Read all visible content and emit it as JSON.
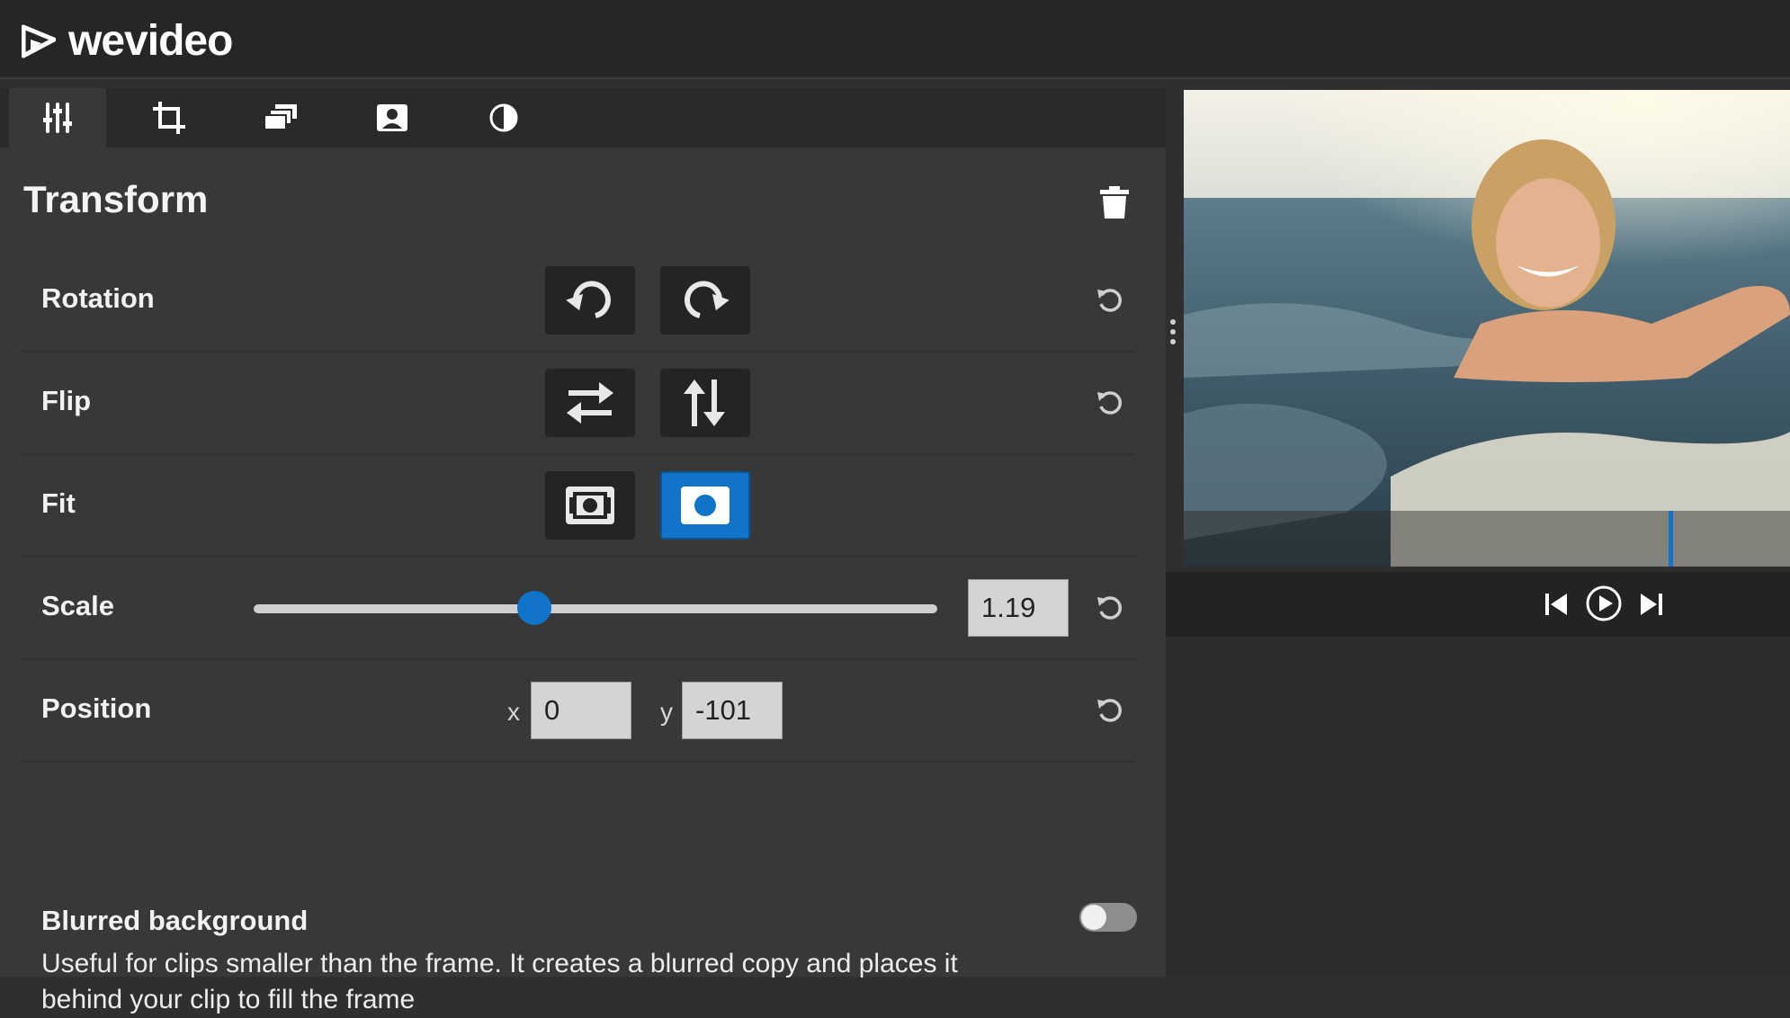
{
  "app": {
    "logo_text": "wevideo"
  },
  "tabs": [
    {
      "name": "adjust",
      "icon": "sliders-icon",
      "active": true
    },
    {
      "name": "crop",
      "icon": "crop-icon",
      "active": false
    },
    {
      "name": "layers",
      "icon": "layers-icon",
      "active": false
    },
    {
      "name": "portrait",
      "icon": "portrait-icon",
      "active": false
    },
    {
      "name": "contrast",
      "icon": "contrast-icon",
      "active": false
    }
  ],
  "panel": {
    "title": "Transform"
  },
  "rows": {
    "rotation": {
      "label": "Rotation"
    },
    "flip": {
      "label": "Flip"
    },
    "fit": {
      "label": "Fit",
      "selected": "fill"
    },
    "scale": {
      "label": "Scale",
      "value": "1.19",
      "slider_fraction": 0.41
    },
    "position": {
      "label": "Position",
      "x_label": "x",
      "x_value": "0",
      "y_label": "y",
      "y_value": "-101"
    }
  },
  "blur": {
    "title": "Blurred background",
    "description": "Useful for clips smaller than the frame. It creates a blurred copy and places it behind your clip to fill the frame",
    "enabled": false
  },
  "player": {
    "playhead_fraction": 0.8
  },
  "colors": {
    "accent": "#1174c9",
    "panel": "#383838",
    "topbar": "#262626"
  }
}
